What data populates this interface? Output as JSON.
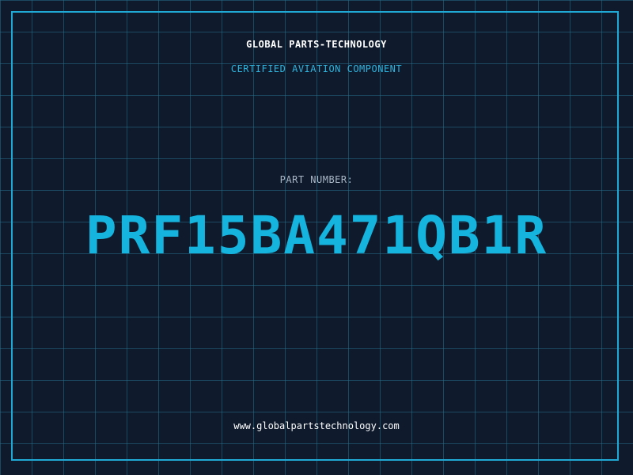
{
  "header": {
    "company": "GLOBAL PARTS-TECHNOLOGY",
    "tagline": "CERTIFIED AVIATION COMPONENT"
  },
  "part": {
    "label": "PART NUMBER:",
    "number": "PRF15BA471QB1R"
  },
  "footer": {
    "website": "www.globalpartstechnology.com"
  },
  "colors": {
    "background": "#0f1b2d",
    "grid": "#286e8c",
    "accent": "#14b4df",
    "frame": "#1fa9d4",
    "label": "#a9b7c6",
    "text": "#ffffff"
  }
}
